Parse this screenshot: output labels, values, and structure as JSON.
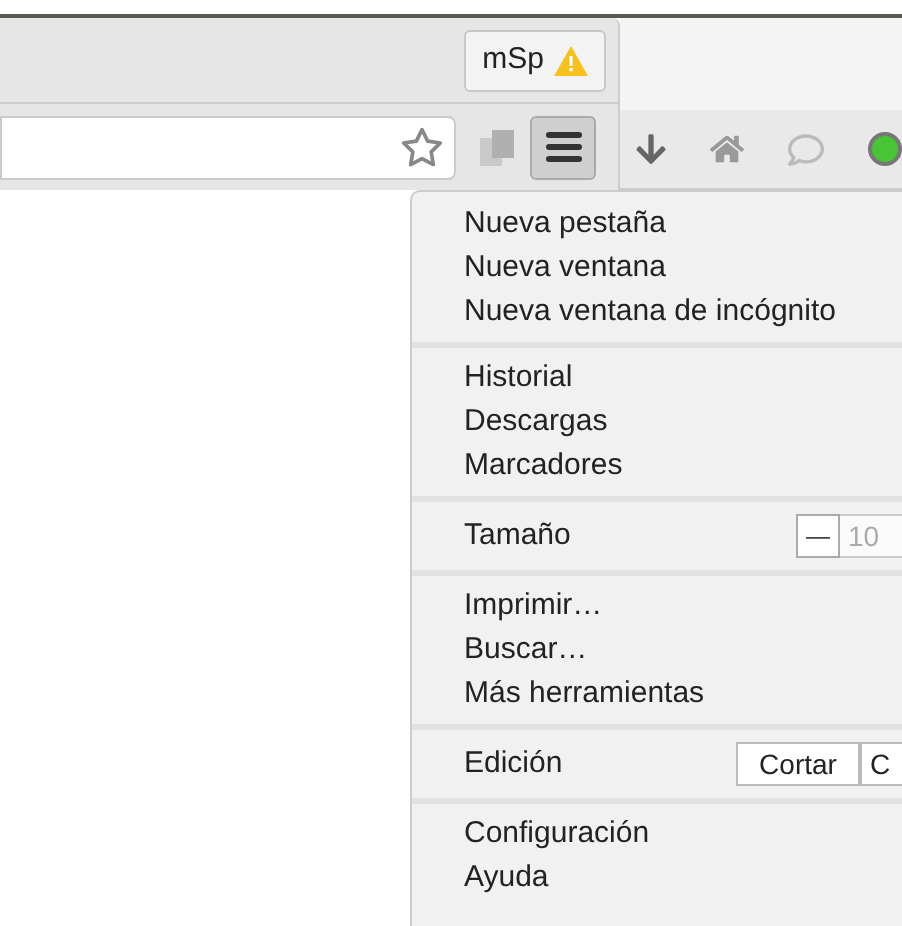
{
  "profile_button": {
    "label": "mSp",
    "warning": true
  },
  "menu": {
    "sections": [
      {
        "items": [
          {
            "kind": "item",
            "label": "Nueva pestaña"
          },
          {
            "kind": "item",
            "label": "Nueva ventana"
          },
          {
            "kind": "item",
            "label": "Nueva ventana de incógnito"
          }
        ]
      },
      {
        "items": [
          {
            "kind": "item",
            "label": "Historial"
          },
          {
            "kind": "item",
            "label": "Descargas"
          },
          {
            "kind": "item",
            "label": "Marcadores"
          }
        ]
      },
      {
        "items": [
          {
            "kind": "zoom",
            "label": "Tamaño",
            "minus": "—",
            "value": "10"
          }
        ]
      },
      {
        "items": [
          {
            "kind": "item",
            "label": "Imprimir…"
          },
          {
            "kind": "item",
            "label": "Buscar…"
          },
          {
            "kind": "item",
            "label": "Más herramientas"
          }
        ]
      },
      {
        "items": [
          {
            "kind": "edit",
            "label": "Edición",
            "buttons": [
              "Cortar",
              "C"
            ]
          }
        ]
      },
      {
        "items": [
          {
            "kind": "item",
            "label": "Configuración"
          },
          {
            "kind": "item",
            "label": "Ayuda"
          }
        ]
      }
    ]
  }
}
